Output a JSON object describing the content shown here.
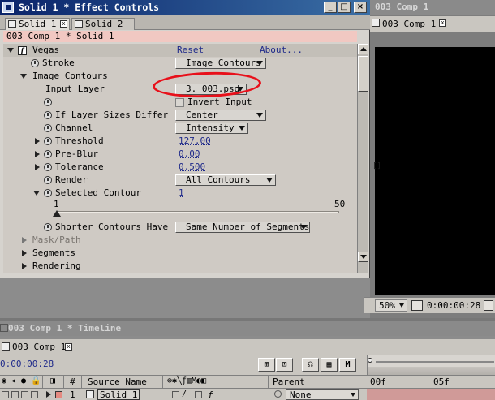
{
  "effect_controls": {
    "title": "Solid 1 * Effect Controls",
    "tabs": [
      {
        "label": "Solid 1",
        "active": true
      },
      {
        "label": "Solid 2",
        "active": false
      }
    ],
    "breadcrumb": "003 Comp 1 * Solid 1",
    "effect": {
      "name": "Vegas",
      "reset": "Reset",
      "about": "About..."
    },
    "rows": {
      "stroke": {
        "label": "Stroke",
        "value": "Image Contours"
      },
      "image_contours": {
        "label": "Image Contours"
      },
      "input_layer": {
        "label": "Input Layer",
        "value": "3. 003.psd"
      },
      "invert_input": {
        "label": "Invert Input"
      },
      "if_layer_sizes": {
        "label": "If Layer Sizes Differ",
        "value": "Center"
      },
      "channel": {
        "label": "Channel",
        "value": "Intensity"
      },
      "threshold": {
        "label": "Threshold",
        "value": "127.00"
      },
      "pre_blur": {
        "label": "Pre-Blur",
        "value": "0.00"
      },
      "tolerance": {
        "label": "Tolerance",
        "value": "0.500"
      },
      "render": {
        "label": "Render",
        "value": "All Contours"
      },
      "selected_contour": {
        "label": "Selected Contour",
        "value": "1"
      },
      "slider": {
        "min": "1",
        "max": "50",
        "value": 1
      },
      "shorter_contours": {
        "label": "Shorter Contours Have",
        "value": "Same Number of Segments"
      },
      "mask_path": {
        "label": "Mask/Path"
      },
      "segments": {
        "label": "Segments"
      },
      "rendering": {
        "label": "Rendering"
      }
    }
  },
  "comp_window": {
    "title": "003 Comp 1",
    "tab": "003 Comp 1",
    "zoom": "50%",
    "timecode": "0:00:00:28"
  },
  "timeline": {
    "title": "003 Comp 1 * Timeline",
    "tab": "003 Comp 1",
    "timecode": "0:00:00:28",
    "columns": {
      "number": "#",
      "source": "Source Name",
      "parent": "Parent"
    },
    "ruler": {
      "start": "00f",
      "mark": "05f"
    },
    "layer": {
      "number": "1",
      "name": "Solid 1",
      "parent": "None"
    }
  },
  "colors": {
    "annotation": "#e8101a",
    "link": "#1f2a8a",
    "breadcrumb_bg": "#f1c8c2"
  }
}
